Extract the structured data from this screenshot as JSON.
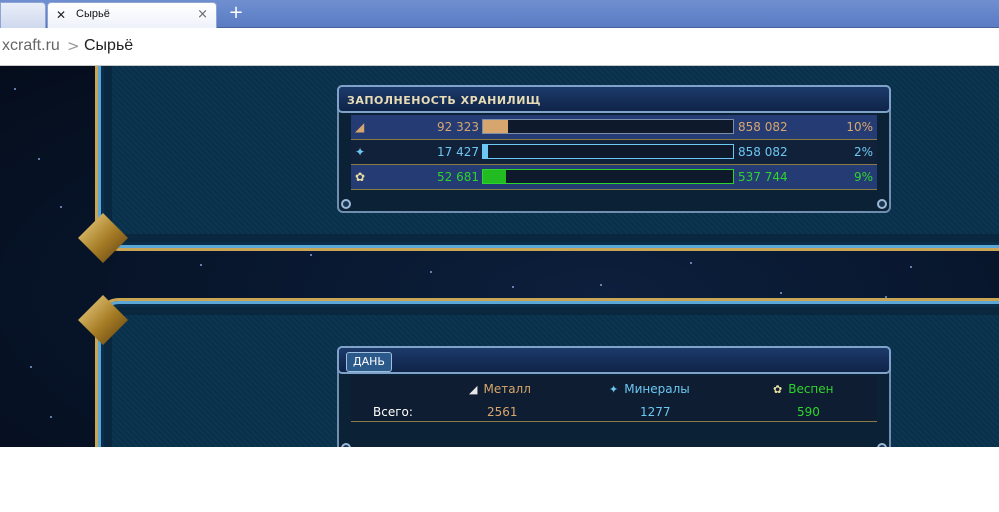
{
  "browser": {
    "prev_tab": "",
    "tab_title": "Сырьё",
    "tab_close": "×",
    "new_tab": "+",
    "address_host": "xcraft.ru",
    "address_sep": ">",
    "address_page": "Сырьё"
  },
  "storage": {
    "title": "ЗАПОЛНЕНОСТЬ ХРАНИЛИЩ",
    "rows": [
      {
        "icon": "metal-icon",
        "amount": "92 323",
        "capacity": "858 082",
        "percent_label": "10%",
        "fill": 10,
        "color": "#d7a66e"
      },
      {
        "icon": "minerals-icon",
        "amount": "17 427",
        "capacity": "858 082",
        "percent_label": "2%",
        "fill": 2,
        "color": "#6cc7f2"
      },
      {
        "icon": "vespene-icon",
        "amount": "52 681",
        "capacity": "537 744",
        "percent_label": "9%",
        "fill": 9,
        "color": "#22bb22"
      }
    ]
  },
  "production": {
    "day_button": "ДАНЬ",
    "headers": {
      "metal": "Металл",
      "minerals": "Минералы",
      "vespene": "Веспен"
    },
    "total_label": "Всего:",
    "totals": {
      "metal": "2561",
      "minerals": "1277",
      "vespene": "590"
    }
  },
  "colors": {
    "metal": "#d7a66e",
    "minerals": "#6cc7f2",
    "vespene": "#2ed42e",
    "frame_gold": "#c9a556",
    "frame_blue": "#5aa7d8"
  }
}
